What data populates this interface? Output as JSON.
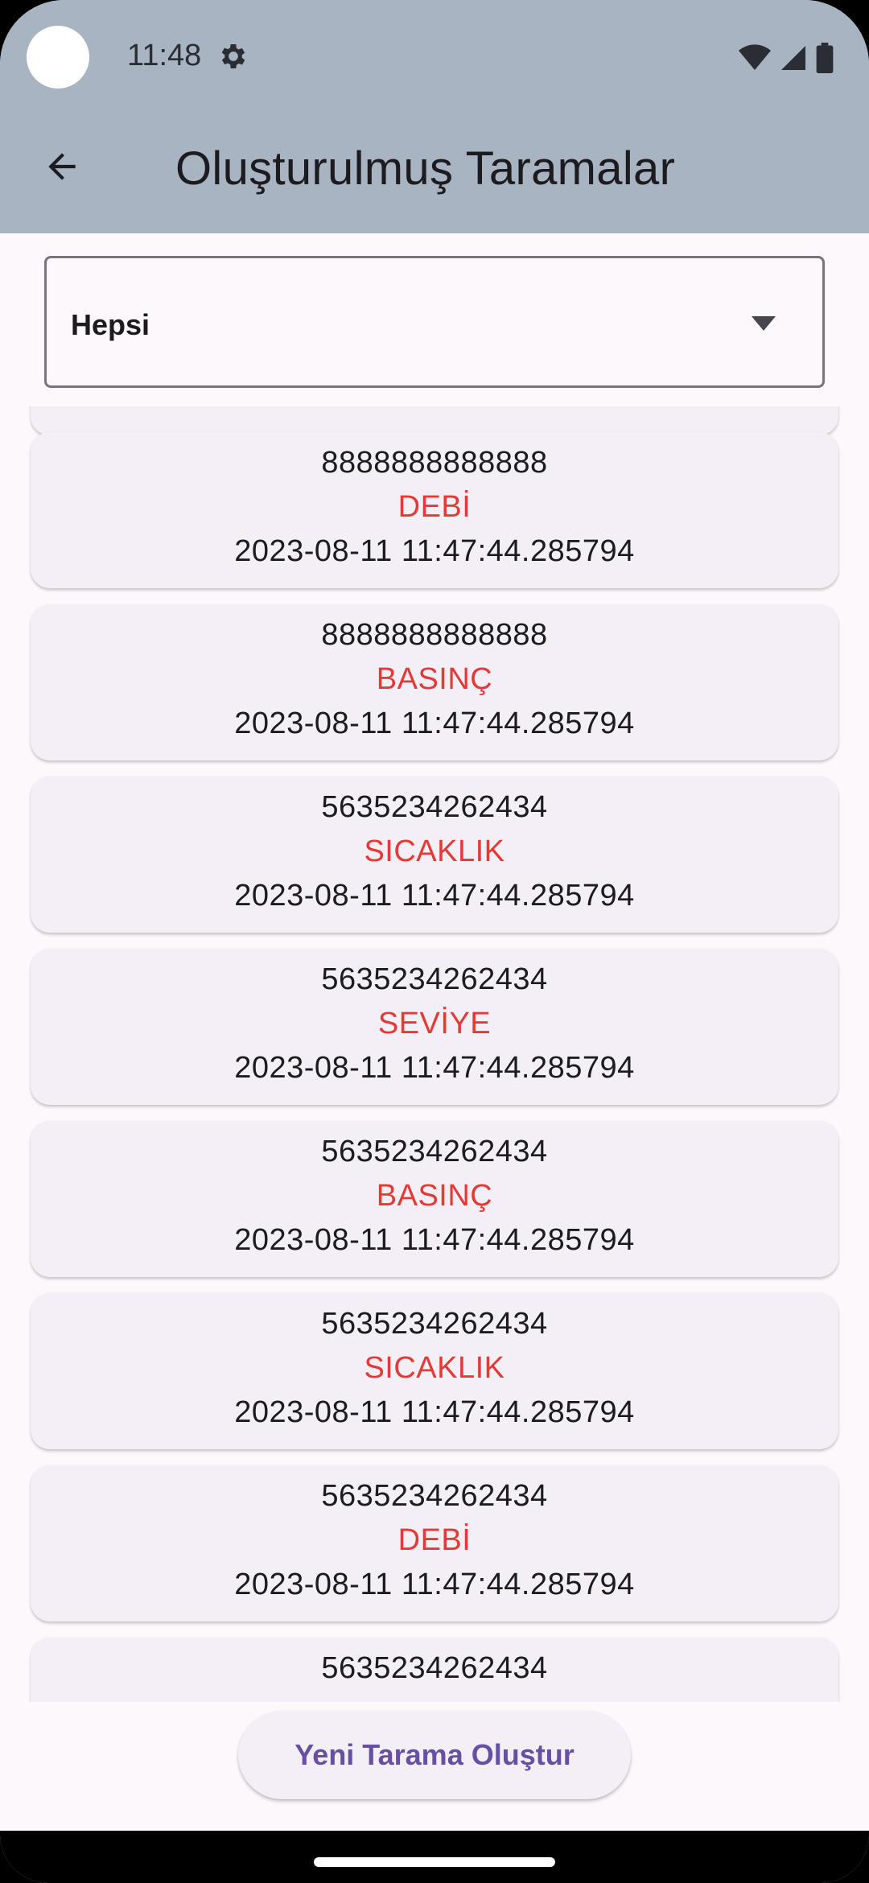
{
  "status_bar": {
    "time": "11:48",
    "icons": [
      "gear-icon",
      "wifi-icon",
      "signal-icon",
      "battery-icon"
    ]
  },
  "app_bar": {
    "title": "Oluşturulmuş Taramalar",
    "back_icon": "arrow-left-icon"
  },
  "filter": {
    "selected": "Hepsi",
    "icon": "dropdown-arrow-icon"
  },
  "scans": [
    {
      "id": "8888888888888",
      "type": "DEBİ",
      "date": "2023-08-11 11:47:44.285794"
    },
    {
      "id": "8888888888888",
      "type": "BASINÇ",
      "date": "2023-08-11 11:47:44.285794"
    },
    {
      "id": "5635234262434",
      "type": "SICAKLIK",
      "date": "2023-08-11 11:47:44.285794"
    },
    {
      "id": "5635234262434",
      "type": "SEVİYE",
      "date": "2023-08-11 11:47:44.285794"
    },
    {
      "id": "5635234262434",
      "type": "BASINÇ",
      "date": "2023-08-11 11:47:44.285794"
    },
    {
      "id": "5635234262434",
      "type": "SICAKLIK",
      "date": "2023-08-11 11:47:44.285794"
    },
    {
      "id": "5635234262434",
      "type": "DEBİ",
      "date": "2023-08-11 11:47:44.285794"
    },
    {
      "id": "5635234262434",
      "type": "",
      "date": ""
    }
  ],
  "actions": {
    "new_scan_label": "Yeni Tarama Oluştur"
  },
  "colors": {
    "app_bar_bg": "#a9b4c2",
    "scan_type": "#e53935",
    "button_text": "#6750a4",
    "card_bg": "#f4eff6"
  }
}
